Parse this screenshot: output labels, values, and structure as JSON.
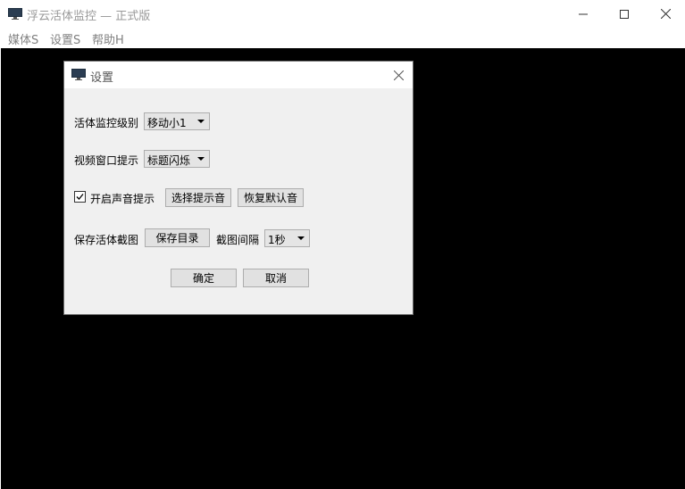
{
  "window": {
    "title": "浮云活体监控 — 正式版"
  },
  "menubar": {
    "items": [
      {
        "label": "媒体S"
      },
      {
        "label": "设置S"
      },
      {
        "label": "帮助H"
      }
    ]
  },
  "dialog": {
    "title": "设置",
    "monitor_level": {
      "label": "活体监控级别",
      "selected": "移动小1"
    },
    "video_hint": {
      "label": "视频窗口提示",
      "selected": "标题闪烁"
    },
    "sound": {
      "checkbox_label": "开启声音提示",
      "checked": true,
      "choose_button": "选择提示音",
      "restore_button": "恢复默认音"
    },
    "screenshot": {
      "label": "保存活体截图",
      "save_dir_button": "保存目录",
      "interval_label": "截图间隔",
      "interval_selected": "1秒"
    },
    "ok_button": "确定",
    "cancel_button": "取消"
  },
  "colors": {
    "canvas": "#000000",
    "dialog_bg": "#f0f0f0",
    "button_bg": "#e1e1e1",
    "menu_text": "#808080"
  }
}
